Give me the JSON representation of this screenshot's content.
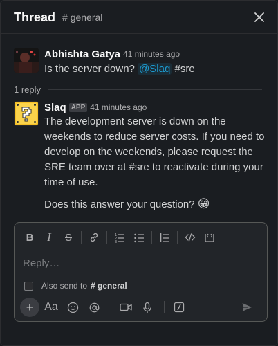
{
  "header": {
    "title": "Thread",
    "channel": "# general",
    "close_icon": "close-icon"
  },
  "parent_message": {
    "author": "Abhishta Gatya",
    "time": "41 minutes ago",
    "text_before": "Is the server down? ",
    "mention": "@Slaq",
    "text_after": " #sre",
    "avatar_icon": "user-avatar"
  },
  "replies": {
    "count": "1 reply"
  },
  "reply_message": {
    "author": "Slaq",
    "badge": "APP",
    "time": "41 minutes ago",
    "paragraph1": "The development server is down on the weekends to reduce server costs. If you need to develop on the weekends, please request the SRE team over at #sre to reactivate during your time of use.",
    "paragraph2": "Does this answer your question?",
    "emoji": "😁",
    "avatar_icon": "question-block-avatar"
  },
  "composer": {
    "placeholder": "Reply…",
    "also_send_label": "Also send to",
    "also_send_channel": "# general",
    "also_send_checked": false,
    "toolbar": [
      "bold-icon",
      "italic-icon",
      "strikethrough-icon",
      "link-icon",
      "ordered-list-icon",
      "bulleted-list-icon",
      "blockquote-icon",
      "code-icon",
      "code-block-icon"
    ],
    "actions": [
      "plus-icon",
      "formatting-icon",
      "emoji-icon",
      "mention-icon",
      "video-icon",
      "microphone-icon",
      "slash-command-icon",
      "send-icon"
    ],
    "format_label": "Aa"
  }
}
